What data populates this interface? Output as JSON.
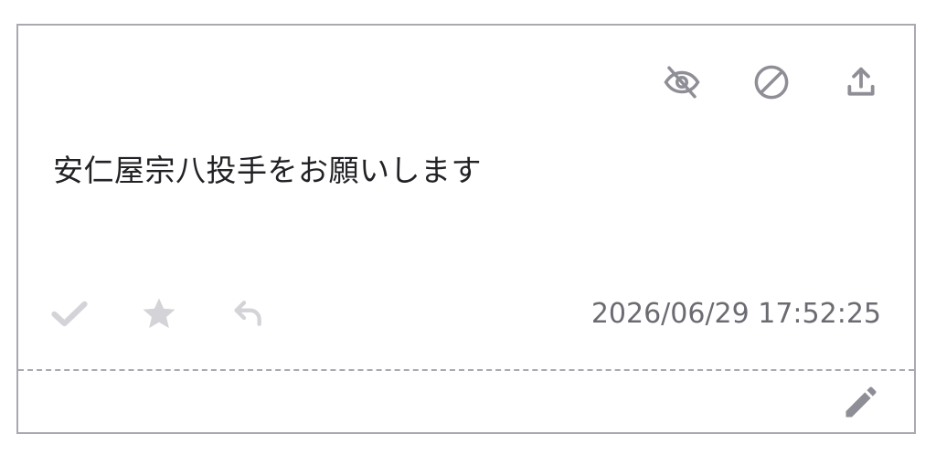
{
  "post": {
    "message": "安仁屋宗八投手をお願いします",
    "timestamp": "2026/06/29 17:52:25"
  },
  "top_actions": [
    {
      "icon": "eye-off-icon"
    },
    {
      "icon": "block-icon"
    },
    {
      "icon": "upload-icon"
    }
  ],
  "bottom_actions": [
    {
      "icon": "check-icon"
    },
    {
      "icon": "star-icon"
    },
    {
      "icon": "reply-icon"
    }
  ],
  "footer": {
    "icon": "pencil-icon"
  },
  "colors": {
    "border": "#a9a9b1",
    "icon_dark": "#8e8e96",
    "icon_light": "#d4d4d8",
    "text": "#222226",
    "muted": "#6b6b72"
  }
}
